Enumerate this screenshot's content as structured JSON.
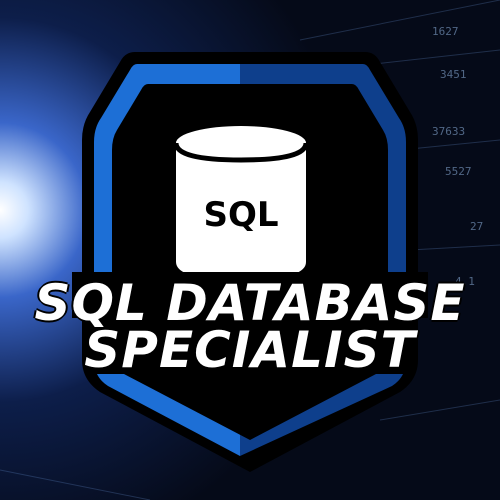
{
  "badge": {
    "icon_label": "SQL",
    "title_line1": "SQL DATABASE",
    "title_line2": "SPECIALIST"
  },
  "background_numbers": [
    "1627",
    "3451",
    "37633",
    "5527",
    "27",
    "4.1"
  ],
  "colors": {
    "background": "#060d1f",
    "accent_blue": "#1d6fd6",
    "accent_blue_dark": "#0e3f8c",
    "badge_black": "#000000",
    "text": "#ffffff"
  }
}
